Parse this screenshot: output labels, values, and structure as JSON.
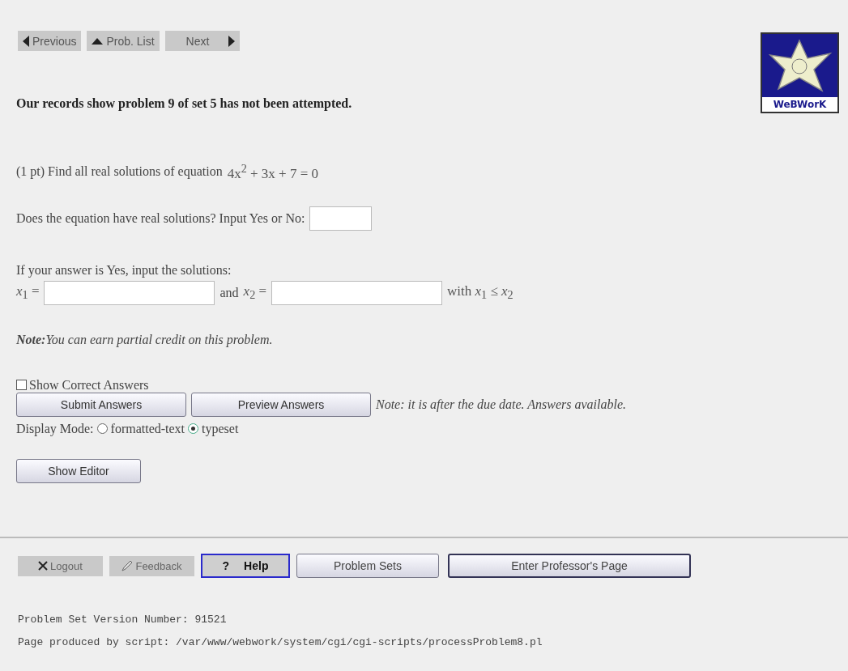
{
  "nav_buttons": [
    {
      "label": "Previous",
      "kind": "previous"
    },
    {
      "label": "Prob. List",
      "kind": "list"
    },
    {
      "label": "Next",
      "kind": "next"
    }
  ],
  "logo": {
    "text": "WeBWorK"
  },
  "status_message": "Our records show problem 9 of set 5 has not been attempted.",
  "problem": {
    "intro": "(1 pt) Find all real solutions of equation",
    "equation": "4x$^{2}$ + 3x + 7 = 0",
    "question": "Does the equation have real solutions? Input Yes or No:",
    "solutions_prompt": "If your answer is Yes, input the solutions:",
    "x1_label": "*x*$_{1}$ =",
    "and_label": "and",
    "x2_label": "*x*$_{2}$ =",
    "constraint": "with *x*$_{1}$ ≤ *x*$_{2}$"
  },
  "note": "**Note:**You can earn partial credit on this problem.",
  "show_correct": {
    "label": "Show Correct Answers",
    "checked": false
  },
  "action_buttons": [
    "Submit Answers",
    "Preview Answers"
  ],
  "due_note": "Note: it is after the due date. Answers available.",
  "display_mode": {
    "label": "Display Mode:",
    "options": [
      {
        "label": "formatted-text",
        "selected": false
      },
      {
        "label": "typeset",
        "selected": true
      }
    ]
  },
  "editor_button": "Show Editor",
  "footer_buttons": [
    {
      "label": "Logout",
      "kind": "logout"
    },
    {
      "label": "Feedback",
      "kind": "feedback"
    },
    {
      "label": "Help",
      "kind": "help",
      "mark": "?"
    },
    {
      "label": "Problem Sets",
      "kind": "raised"
    },
    {
      "label": "Enter Professor's Page",
      "kind": "raised-strong"
    }
  ],
  "version": "Problem Set Version Number: 91521",
  "script_line": "Page produced by script: /var/www/webwork/system/cgi/cgi-scripts/processProblem8.pl"
}
